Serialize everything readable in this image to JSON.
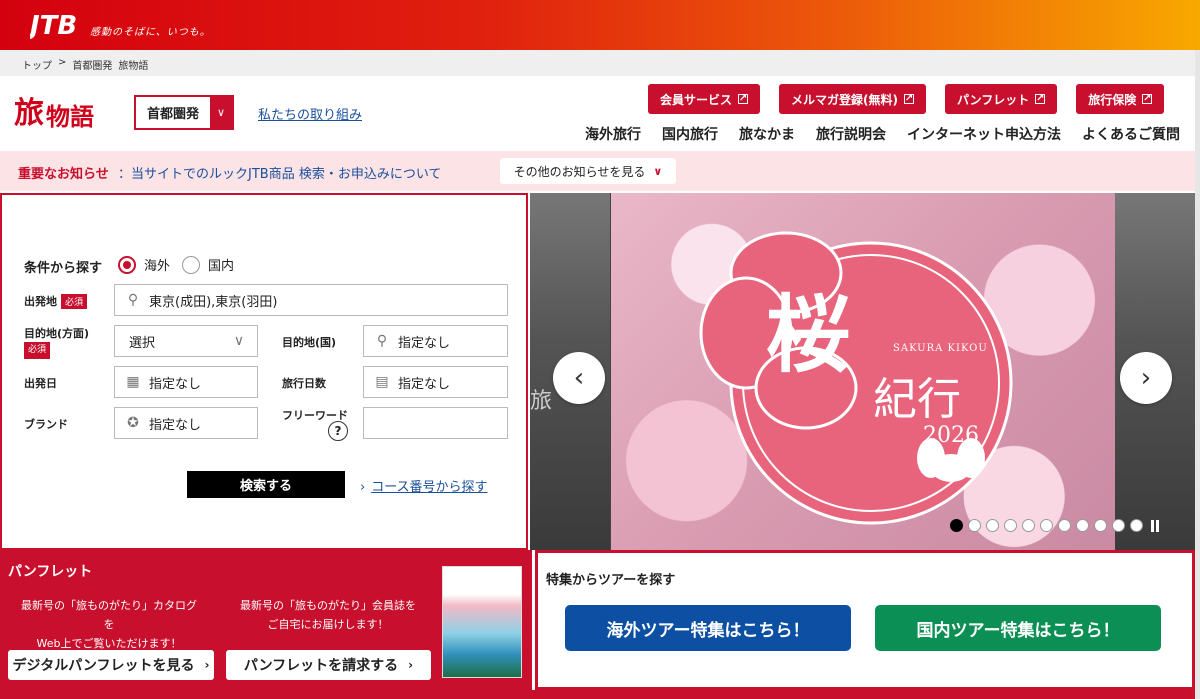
{
  "header": {
    "logo_text": "JTB",
    "tagline": "感動のそばに、いつも。",
    "breadcrumb": [
      "トップ",
      "首都圏発",
      "旅物語"
    ],
    "breadcrumb_sep": ">",
    "brand": {
      "part1": "旅",
      "part2": "物語"
    },
    "region_select": "首都圏発",
    "initiatives_link": "私たちの取り組み",
    "buttons": [
      "会員サービス",
      "メルマガ登録(無料)",
      "パンフレット",
      "旅行保険"
    ],
    "nav": [
      "海外旅行",
      "国内旅行",
      "旅なかま",
      "旅行説明会",
      "インターネット申込方法",
      "よくあるご質問"
    ]
  },
  "notice": {
    "title": "重要なお知らせ",
    "message": "：当サイトでのルックJTB商品 検索・お申込みについて",
    "more": "その他のお知らせを見る"
  },
  "search": {
    "title": "条件から探す",
    "radio_overseas": "海外",
    "radio_domestic": "国内",
    "required": "必須",
    "departure_label": "出発地",
    "departure_value": "東京(成田),東京(羽田)",
    "destination_area_label": "目的地(方面)",
    "destination_area_value": "選択",
    "destination_country_label": "目的地(国)",
    "destination_country_value": "指定なし",
    "date_label": "出発日",
    "date_value": "指定なし",
    "days_label": "旅行日数",
    "days_value": "指定なし",
    "brand_label": "ブランド",
    "brand_value": "指定なし",
    "freeword_label": "フリーワード",
    "freeword_value": "",
    "help": "?",
    "search_button": "検索する",
    "course_link": "コース番号から探す"
  },
  "carousel": {
    "side_char": "旅",
    "kanji_main": "桜",
    "kanji_sub": "紀行",
    "english": "SAKURA KIKOU",
    "year": "2026",
    "dots_total": 11,
    "active_dot": 0
  },
  "pamphlet": {
    "title": "パンフレット",
    "desc1_line1": "最新号の「旅ものがたり」カタログを",
    "desc1_line2": "Web上でご覧いただけます！",
    "desc2_line1": "最新号の「旅ものがたり」会員誌を",
    "desc2_line2": "ご自宅にお届けします！",
    "btn_digital": "デジタルパンフレットを見る",
    "btn_request": "パンフレットを請求する"
  },
  "features": {
    "title": "特集からツアーを探す",
    "overseas": "海外ツアー特集はこちら！",
    "domestic": "国内ツアー特集はこちら！"
  },
  "colors": {
    "brand_red": "#c8102e",
    "overseas_blue": "#0d4fa3",
    "domestic_green": "#0b8f55"
  }
}
